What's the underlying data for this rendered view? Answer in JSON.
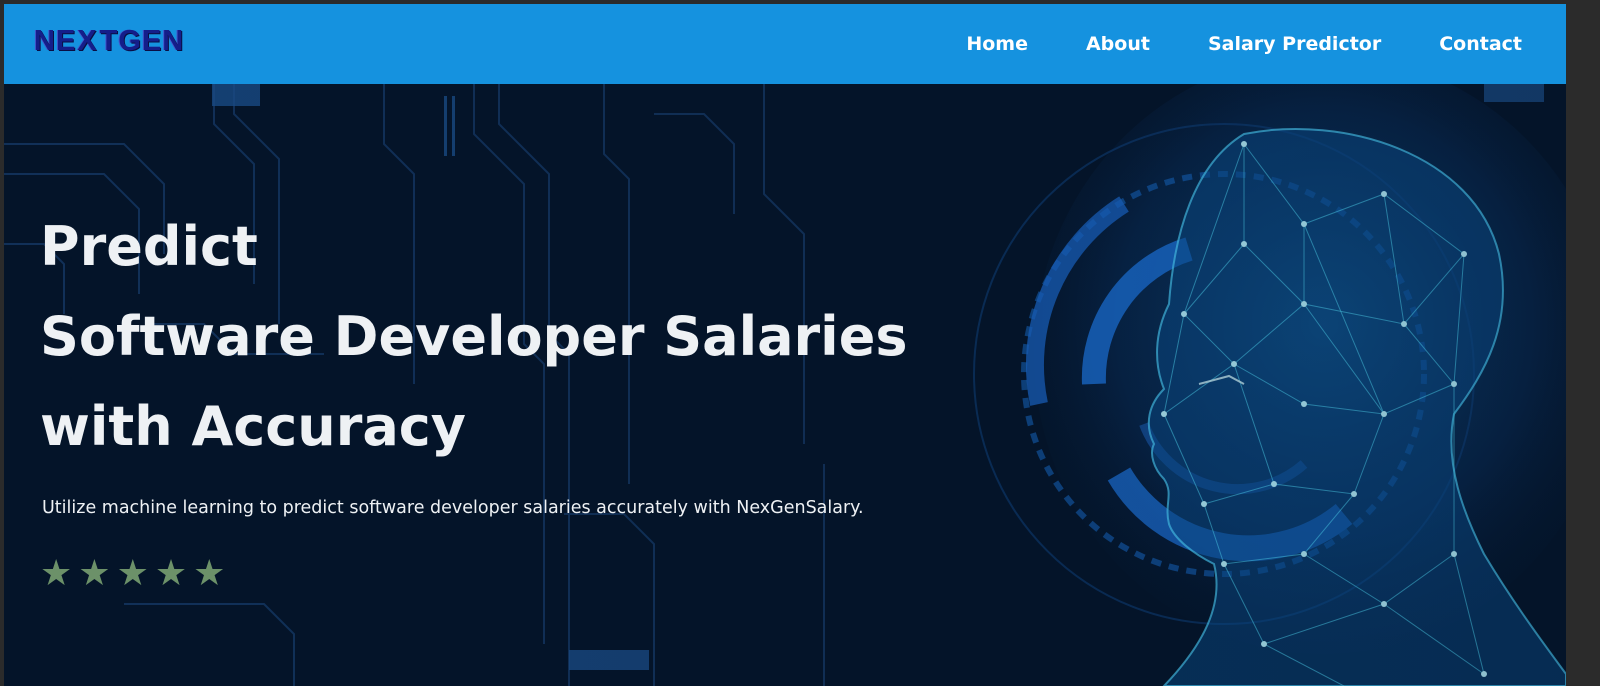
{
  "colors": {
    "navbar": "#1592df",
    "hero_background": "#041429",
    "logo": "#141e8a",
    "star": "#6c9169",
    "hero_text": "#eef1f4"
  },
  "logo": {
    "part1": "NE",
    "part2": "X",
    "part3": "TGEN"
  },
  "nav": {
    "items": [
      {
        "label": "Home"
      },
      {
        "label": "About"
      },
      {
        "label": "Salary Predictor"
      },
      {
        "label": "Contact"
      }
    ]
  },
  "hero": {
    "title_lines": [
      "Predict",
      "Software Developer Salaries",
      "with Accuracy"
    ],
    "subtitle": "Utilize machine learning to predict software developer salaries accurately with NexGenSalary.",
    "rating": {
      "value": 5,
      "max": 5,
      "icon": "star-icon"
    },
    "illustration": "ai-wireframe-head-illustration"
  }
}
